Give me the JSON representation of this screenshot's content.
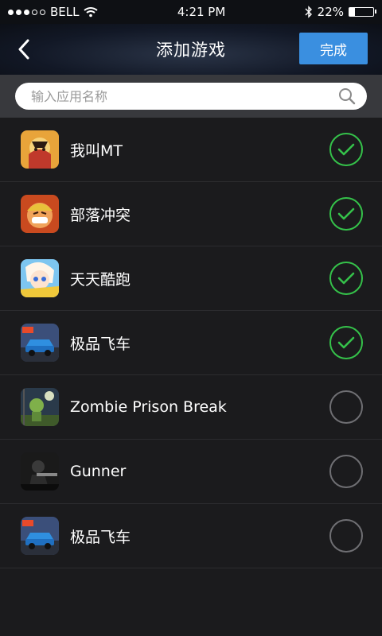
{
  "status": {
    "carrier": "BELL",
    "time": "4:21 PM",
    "battery": "22%"
  },
  "header": {
    "title": "添加游戏",
    "done_label": "完成"
  },
  "search": {
    "placeholder": "输入应用名称"
  },
  "apps": [
    {
      "name": "我叫MT",
      "checked": true
    },
    {
      "name": "部落冲突",
      "checked": true
    },
    {
      "name": "天天酷跑",
      "checked": true
    },
    {
      "name": "极品飞车",
      "checked": true
    },
    {
      "name": "Zombie Prison Break",
      "checked": false
    },
    {
      "name": "Gunner",
      "checked": false
    },
    {
      "name": "极品飞车",
      "checked": false
    }
  ],
  "colors": {
    "accent": "#3a8fe0",
    "check": "#35c24a",
    "background": "#1b1b1d"
  }
}
